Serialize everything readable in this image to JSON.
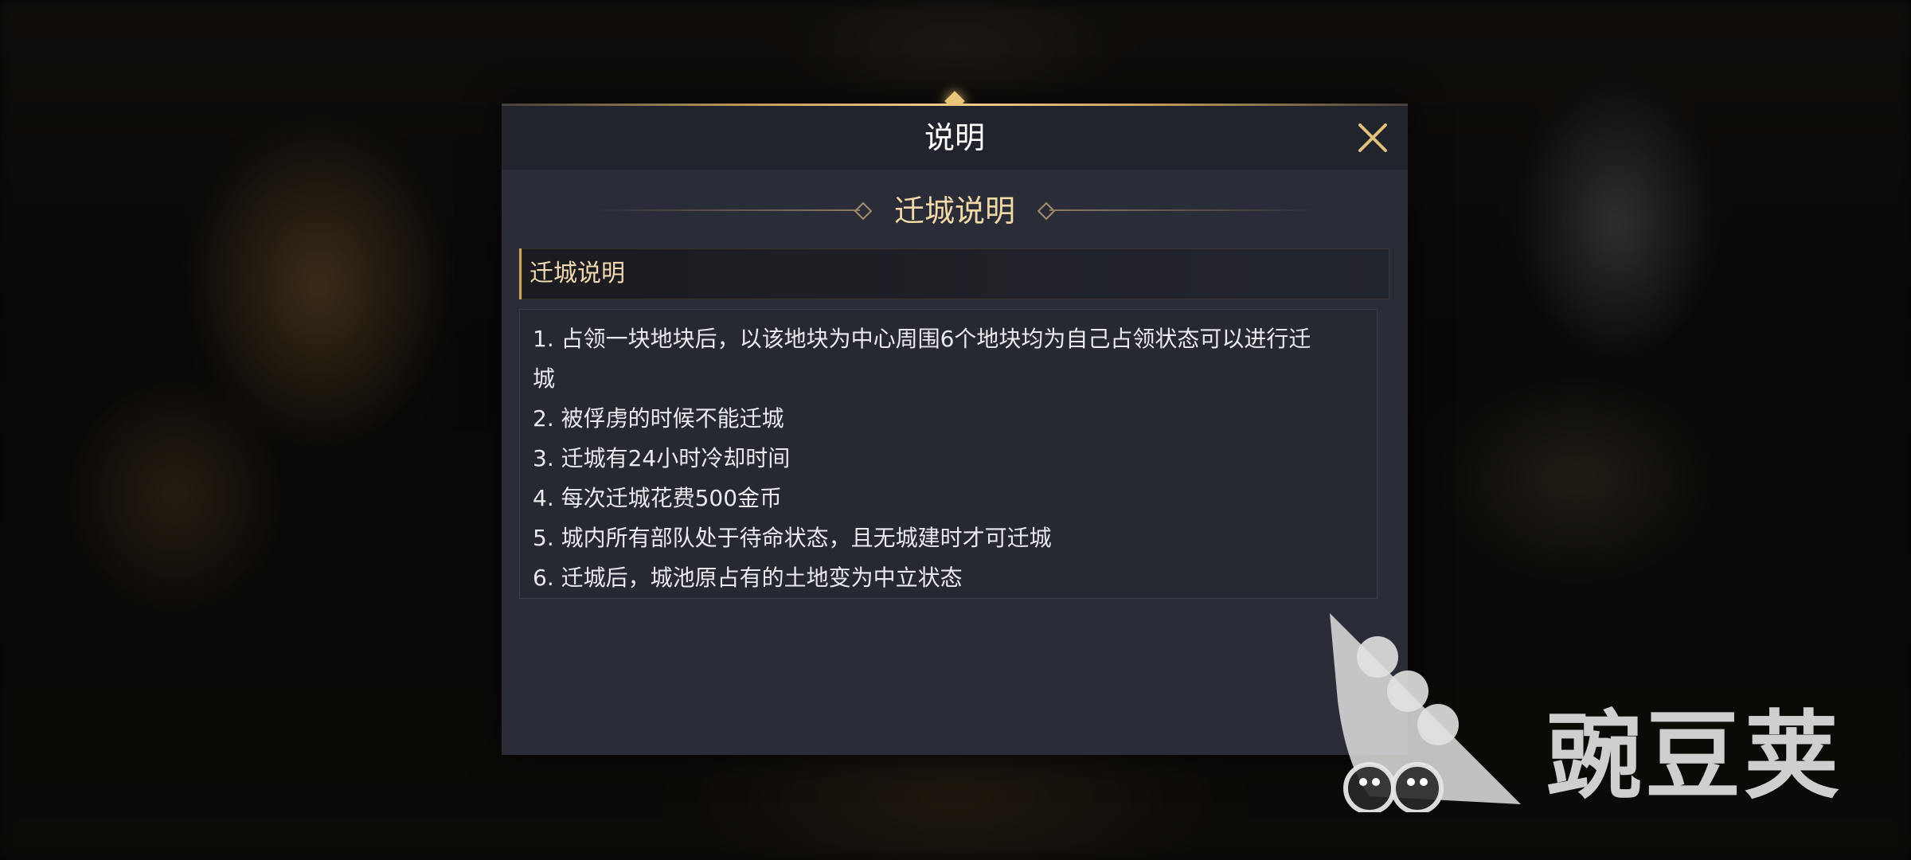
{
  "dialog": {
    "title": "说明",
    "section_heading": "迁城说明",
    "tab_label": "迁城说明",
    "rules": [
      "1. 占领一块地块后，以该地块为中心周围6个地块均为自己占领状态可以进行迁",
      "城",
      "2. 被俘虏的时候不能迁城",
      "3. 迁城有24小时冷却时间",
      "4. 每次迁城花费500金币",
      "5. 城内所有部队处于待命状态，且无城建时才可迁城",
      "6. 迁城后，城池原占有的土地变为中立状态"
    ],
    "close_icon": "close-icon",
    "accent_color": "#c9a35c"
  },
  "watermark": {
    "text": "豌豆荚",
    "icon": "pea-pod-logo"
  }
}
